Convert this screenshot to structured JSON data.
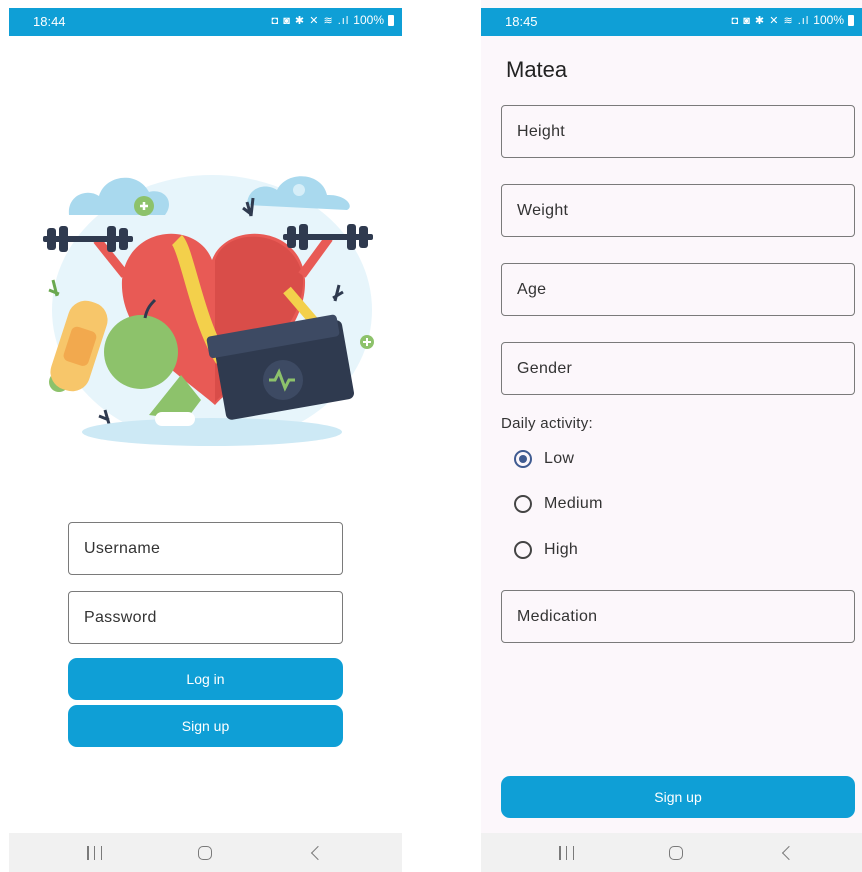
{
  "left_screen": {
    "status_bar": {
      "time": "18:44",
      "battery": "100%"
    },
    "username": {
      "placeholder": "Username"
    },
    "password": {
      "placeholder": "Password"
    },
    "login_label": "Log in",
    "signup_label": "Sign up"
  },
  "right_screen": {
    "status_bar": {
      "time": "18:45",
      "battery": "100%"
    },
    "title": "Matea",
    "height": {
      "placeholder": "Height"
    },
    "weight": {
      "placeholder": "Weight"
    },
    "age": {
      "placeholder": "Age"
    },
    "gender": {
      "placeholder": "Gender"
    },
    "activity_label": "Daily activity:",
    "activity_options": [
      "Low",
      "Medium",
      "High"
    ],
    "activity_selected": "Low",
    "medication": {
      "placeholder": "Medication"
    },
    "signup_label": "Sign up"
  },
  "colors": {
    "accent": "#0f9fd6",
    "radio_selected": "#3f5b91",
    "heart": "#e85a55",
    "briefcase": "#2f3a4f",
    "apple": "#8dc26b"
  }
}
